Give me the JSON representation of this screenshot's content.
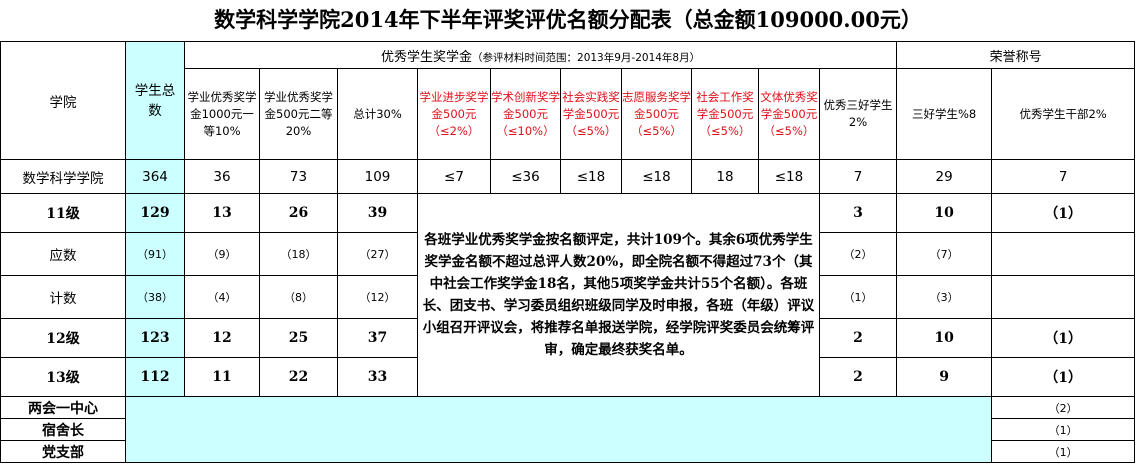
{
  "title": "数学科学学院2014年下半年评奖评优名额分配表（总金额109000.00元）",
  "header": {
    "college": "学院",
    "total_students": "学生总数",
    "scholarship_group": "优秀学生奖学金",
    "scholarship_range": "（参评材料时间范围：2013年9月-2014年8月）",
    "honor_group": "荣誉称号",
    "col_first": "学业优秀奖学金1000元一等10%",
    "col_second": "学业优秀奖学金500元二等20%",
    "col_total": "总计30%",
    "col_progress": "学业进步奖学金500元（≤2%）",
    "col_innovation": "学术创新奖学金500元（≤10%）",
    "col_practice": "社会实践奖学金500元（≤5%）",
    "col_volunteer": "志愿服务奖学金500元（≤5%）",
    "col_social_work": "社会工作奖学金500元（≤5%）",
    "col_sports": "文体优秀奖学金500元（≤5%）",
    "col_merit": "优秀三好学生2%",
    "col_three_good": "三好学生%8",
    "col_cadre": "优秀学生干部2%"
  },
  "rows": [
    {
      "label": "数学科学学院",
      "total": "364",
      "first": "36",
      "second": "73",
      "sum": "109",
      "progress": "≤7",
      "innovation": "≤36",
      "practice": "≤18",
      "volunteer": "≤18",
      "social": "18",
      "sports": "≤18",
      "merit": "7",
      "three_good": "29",
      "cadre": "7"
    },
    {
      "label": "11级",
      "total": "129",
      "first": "13",
      "second": "26",
      "sum": "39",
      "merit": "3",
      "three_good": "10",
      "cadre": "（1）"
    },
    {
      "label": "应数",
      "total": "（91）",
      "first": "（9）",
      "second": "（18）",
      "sum": "（27）",
      "merit": "（2）",
      "three_good": "（7）",
      "cadre": ""
    },
    {
      "label": "计数",
      "total": "（38）",
      "first": "（4）",
      "second": "（8）",
      "sum": "（12）",
      "merit": "（1）",
      "three_good": "（3）",
      "cadre": ""
    },
    {
      "label": "12级",
      "total": "123",
      "first": "12",
      "second": "25",
      "sum": "37",
      "merit": "2",
      "three_good": "10",
      "cadre": "（1）"
    },
    {
      "label": "13级",
      "total": "112",
      "first": "11",
      "second": "22",
      "sum": "33",
      "merit": "2",
      "three_good": "9",
      "cadre": "（1）"
    }
  ],
  "note": "各班学业优秀奖学金按名额评定，共计109个。其余6项优秀学生奖学金名额不超过总评人数20%，即全院名额不得超过73个（其中社会工作奖学金18名，其他5项奖学金共计55个名额）。各班长、团支书、学习委员组织班级同学及时申报，各班（年级）评议小组召开评议会，将推荐名单报送学院，经学院评奖委员会统筹评审，确定最终获奖名单。",
  "extra_rows": [
    {
      "label": "两会一中心",
      "cadre": "（2）"
    },
    {
      "label": "宿舍长",
      "cadre": "（1）"
    },
    {
      "label": "党支部",
      "cadre": "（1）"
    }
  ],
  "colors": {
    "highlight": "#ccffff",
    "red_text": "#e0101a"
  }
}
